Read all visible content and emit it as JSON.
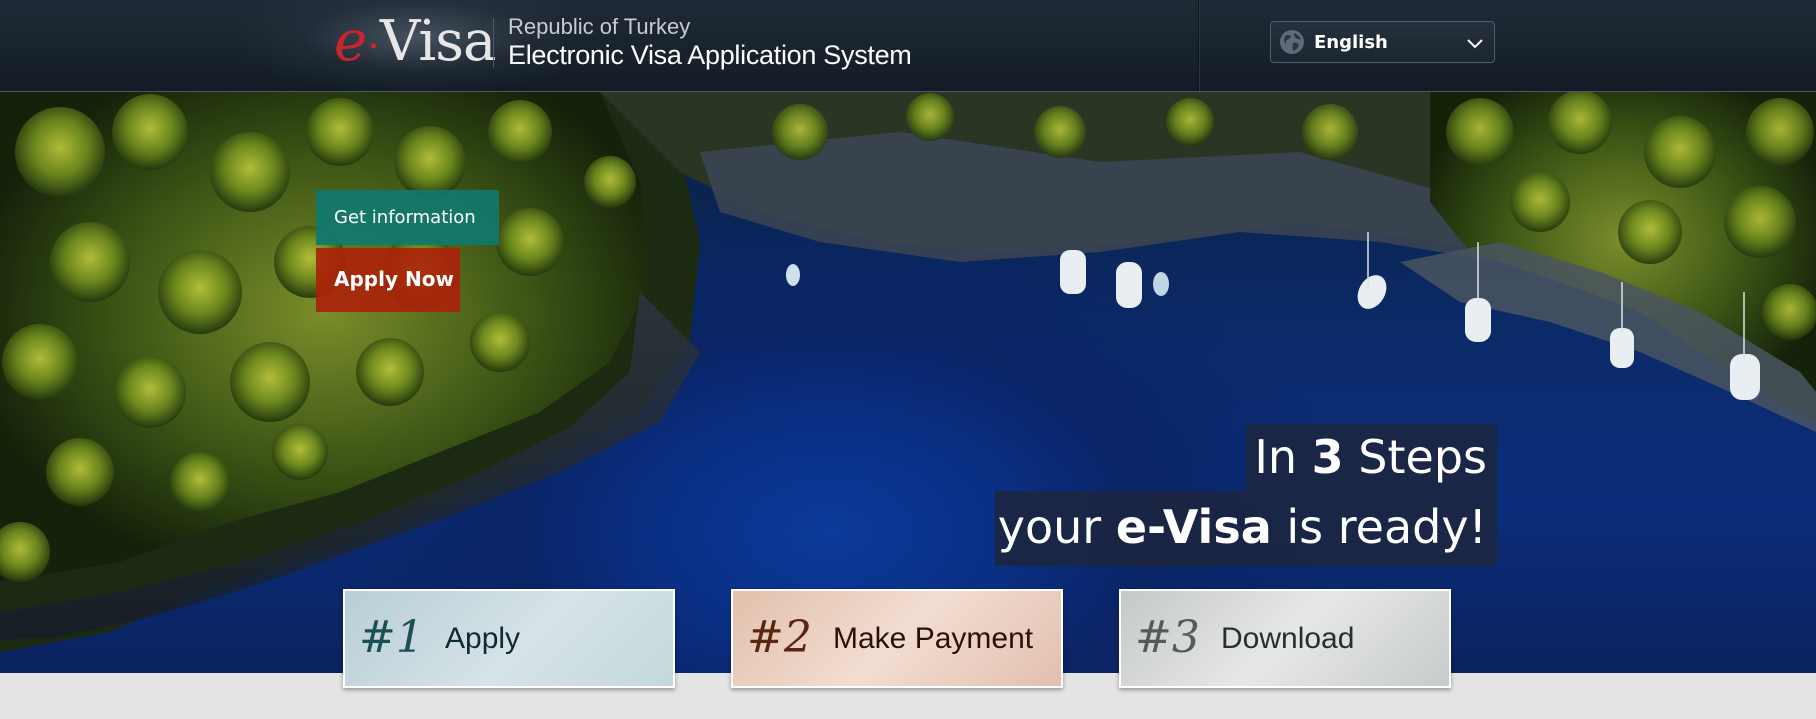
{
  "header": {
    "logo": {
      "e": "e",
      "rest": "Visa"
    },
    "subtitle": "Republic of Turkey",
    "title": "Electronic Visa Application System",
    "language": {
      "selected": "English",
      "icon": "globe-icon",
      "chevron": "chevron-down-icon"
    }
  },
  "hero": {
    "get_info_label": "Get information",
    "apply_now_label": "Apply Now",
    "tagline": {
      "line1_pre": "In ",
      "line1_bold": "3",
      "line1_post": " Steps",
      "line2_pre": "your ",
      "line2_bold": "e-Visa",
      "line2_post": " is ready!"
    }
  },
  "steps": [
    {
      "number": "#1",
      "label": "Apply"
    },
    {
      "number": "#2",
      "label": "Make Payment"
    },
    {
      "number": "#3",
      "label": "Download"
    }
  ],
  "colors": {
    "header_bg": "#18222d",
    "info_button": "#10786e",
    "apply_button": "#aa230a",
    "logo_accent": "#c9252c",
    "tagline_bg": "#1c2642"
  }
}
